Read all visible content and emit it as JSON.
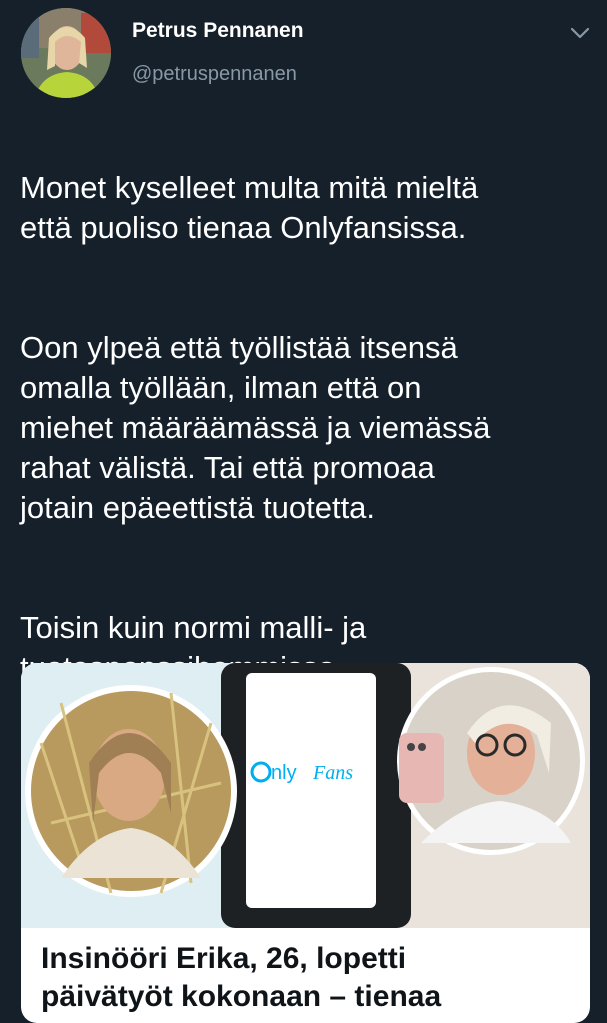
{
  "author": {
    "name": "Petrus Pennanen",
    "handle": "@petruspennanen"
  },
  "tweet": {
    "paragraphs": [
      "Monet kyselleet multa mitä mieltä\nettä puoliso tienaa Onlyfansissa.",
      "Oon ylpeä että työllistää itsensä\nomalla työllään, ilman että on\nmiehet määräämässä ja viemässä\nrahat välistä. Tai että promoaa\njotain epäeettistä tuotetta.",
      "Toisin kuin normi malli- ja\ntuotesponssihommissa."
    ]
  },
  "card": {
    "logo_text_a": "nly",
    "logo_text_b": "Fans",
    "title": "Insinööri Erika, 26, lopetti\npäivätyöt kokonaan – tienaa"
  },
  "icons": {
    "menu": "chevron-down-icon"
  },
  "colors": {
    "background": "#15202b",
    "secondary_text": "#8899a6",
    "onlyfans_blue": "#00aeef"
  }
}
